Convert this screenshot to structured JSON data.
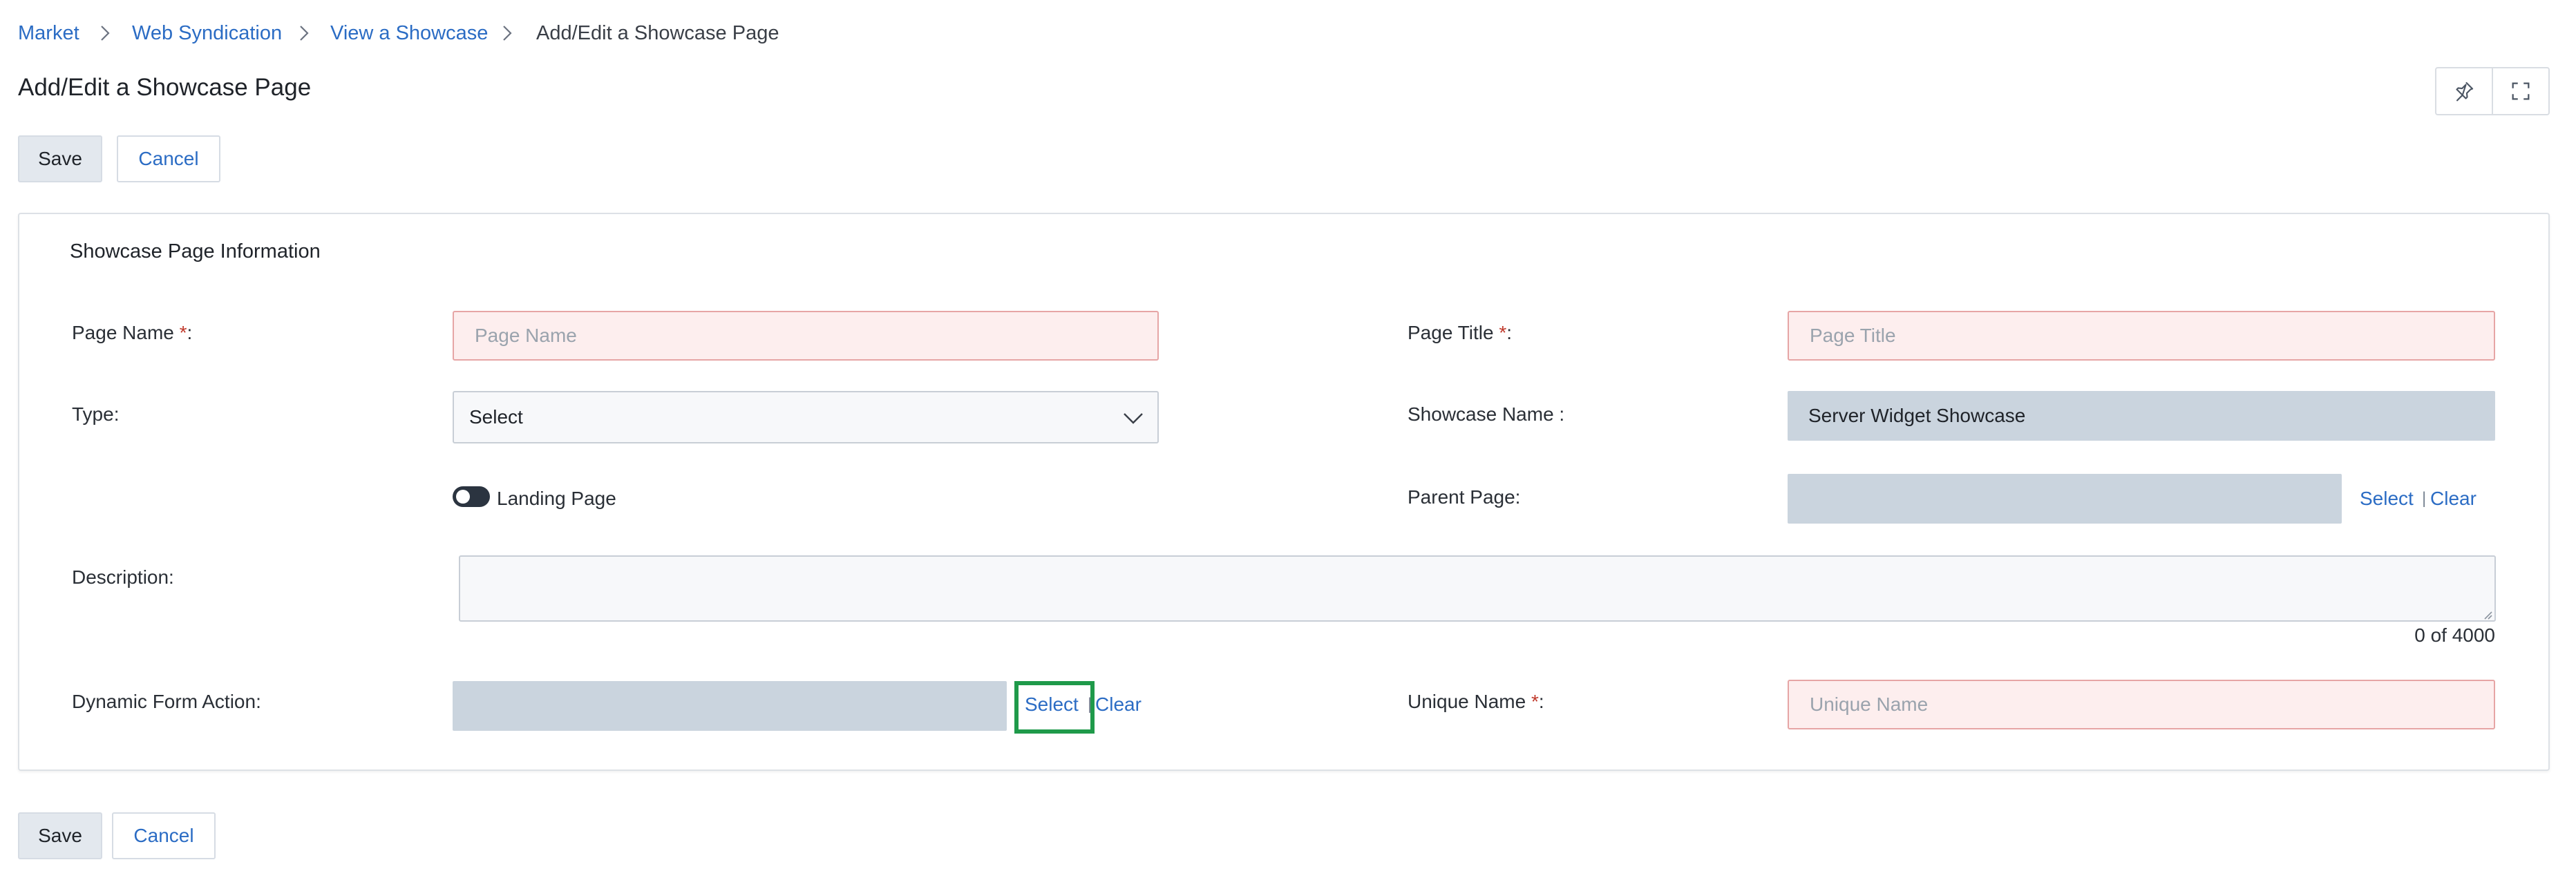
{
  "breadcrumb": {
    "items": [
      "Market",
      "Web Syndication",
      "View a Showcase"
    ],
    "current": "Add/Edit a Showcase Page"
  },
  "page": {
    "title": "Add/Edit a Showcase Page"
  },
  "toolbar": {
    "save_label": "Save",
    "cancel_label": "Cancel"
  },
  "header_icons": [
    "pin-icon",
    "fullscreen-icon"
  ],
  "form": {
    "section_title": "Showcase Page Information",
    "page_name": {
      "label": "Page Name ",
      "required_mark": "*",
      "suffix": ":",
      "placeholder": "Page Name",
      "value": ""
    },
    "page_title": {
      "label": "Page Title ",
      "required_mark": "*",
      "suffix": ":",
      "placeholder": "Page Title",
      "value": ""
    },
    "type": {
      "label": "Type:",
      "selected": "Select"
    },
    "showcase_name": {
      "label": "Showcase Name :",
      "value": "Server Widget Showcase"
    },
    "landing_page": {
      "label": "Landing Page",
      "checked": false
    },
    "parent_page": {
      "label": "Parent Page:",
      "value": "",
      "select_label": "Select",
      "separator": "|",
      "clear_label": "Clear"
    },
    "description": {
      "label": "Description:",
      "value": "",
      "counter": "0 of 4000"
    },
    "dynamic_form_action": {
      "label": "Dynamic Form Action:",
      "value": "",
      "select_label": "Select",
      "separator": "|",
      "clear_label": "Clear"
    },
    "unique_name": {
      "label": "Unique Name ",
      "required_mark": "*",
      "suffix": ":",
      "placeholder": "Unique Name",
      "value": ""
    }
  },
  "colors": {
    "link": "#2b6cc4",
    "required_bg": "#fdeeee",
    "required_border": "#e6a5a5",
    "readonly_bg": "#cad4de",
    "highlight": "#1f9a4a",
    "required_mark": "#c0392b"
  }
}
